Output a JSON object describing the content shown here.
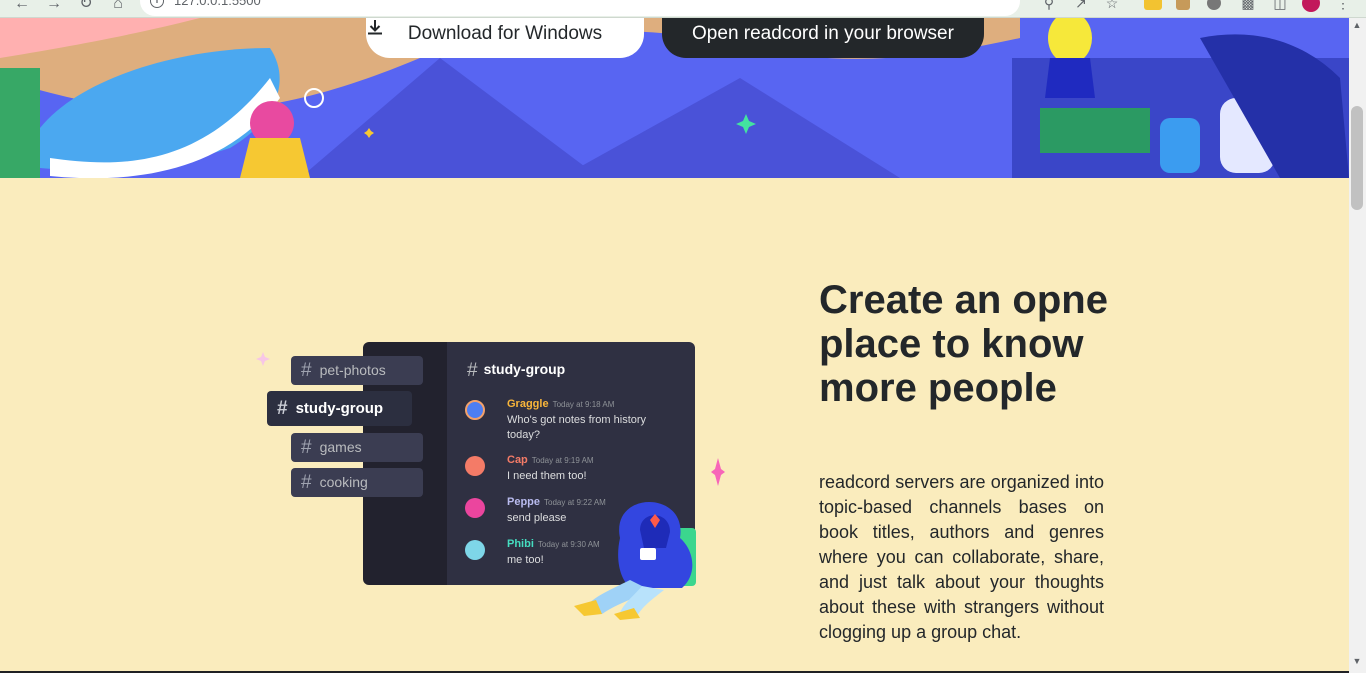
{
  "browser": {
    "url": "127.0.0.1:5500",
    "icons": [
      "back-icon",
      "forward-icon",
      "reload-icon",
      "home-icon"
    ],
    "extension_icons": [
      "zoom-icon",
      "share-icon",
      "star-icon",
      "extension-yellow-icon",
      "extension-brown-icon",
      "extension-gray-icon",
      "puzzle-icon",
      "sidepanel-icon",
      "profile-icon",
      "menu-icon"
    ]
  },
  "hero": {
    "download_label": "Download for Windows",
    "open_label": "Open readcord in your browser"
  },
  "feature": {
    "channels": [
      {
        "label": "pet-photos",
        "active": false
      },
      {
        "label": "study-group",
        "active": true
      },
      {
        "label": "games",
        "active": false
      },
      {
        "label": "cooking",
        "active": false
      }
    ],
    "panel_title": "study-group",
    "messages": [
      {
        "name": "Graggle",
        "time": "Today at 9:18 AM",
        "text": "Who's got notes from history today?",
        "color": "#f9b63a"
      },
      {
        "name": "Cap",
        "time": "Today at 9:19 AM",
        "text": "I need them too!",
        "color": "#f47b67"
      },
      {
        "name": "Peppe",
        "time": "Today at 9:22 AM",
        "text": "send please",
        "color": "#b9bbef"
      },
      {
        "name": "Phibi",
        "time": "Today at 9:30 AM",
        "text": "me too!",
        "color": "#45ddc0"
      }
    ],
    "headline": "Create an opne place to know more people",
    "body": "readcord servers are organized into topic-based channels bases on book titles, authors and genres where you can collaborate, share, and just talk about your thoughts about these with strangers without clogging up a group chat."
  },
  "colors": {
    "blurple": "#5865f2",
    "cream": "#faecbd",
    "dark": "#23272a"
  }
}
